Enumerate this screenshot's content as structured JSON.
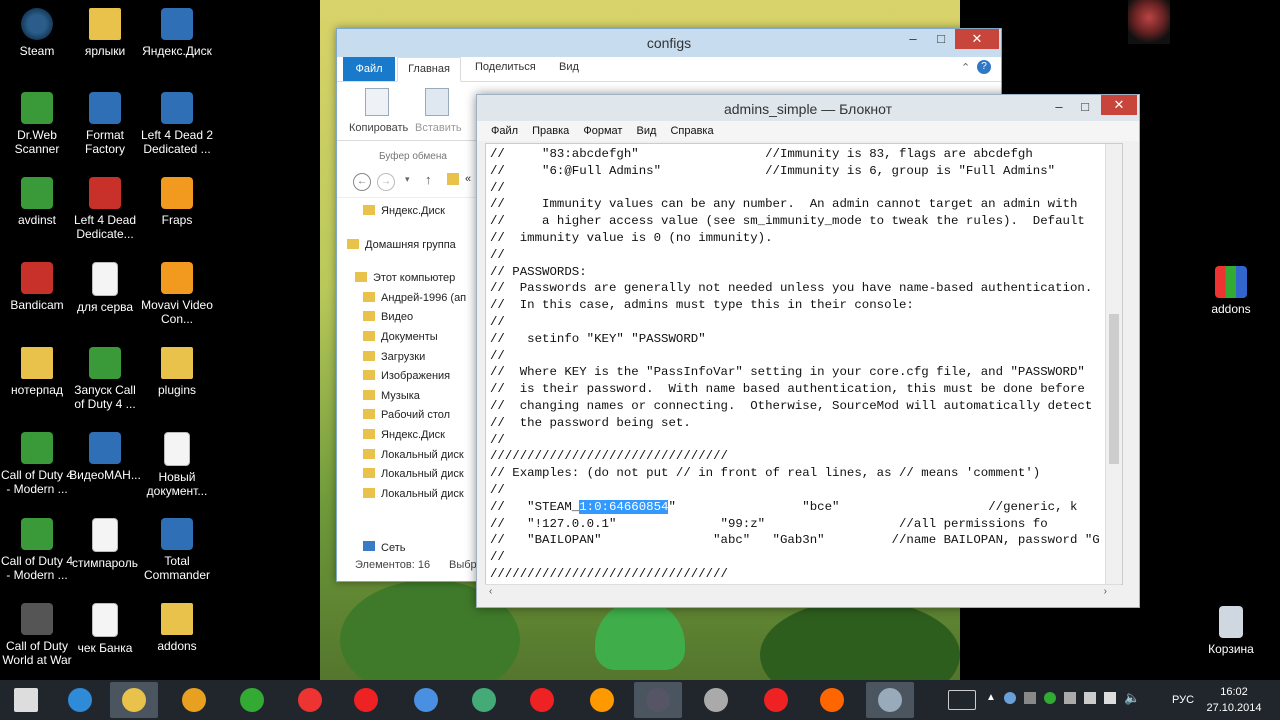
{
  "desktop": {
    "left_icons": [
      {
        "label": "Steam",
        "icon": "steam-icon"
      },
      {
        "label": "ярлыки",
        "icon": "folder-icon"
      },
      {
        "label": "Яндекс.Диск",
        "icon": "yandex-disk-icon"
      },
      {
        "label": "Dr.Web Scanner",
        "icon": "drweb-icon"
      },
      {
        "label": "Format Factory",
        "icon": "format-factory-icon"
      },
      {
        "label": "Left 4 Dead 2 Dedicated ...",
        "icon": "shortcut-icon"
      },
      {
        "label": "avdinst",
        "icon": "avdinst-icon"
      },
      {
        "label": "Left 4 Dead Dedicate...",
        "icon": "left4dead-icon"
      },
      {
        "label": "Fraps",
        "icon": "fraps-icon"
      },
      {
        "label": "Bandicam",
        "icon": "bandicam-icon"
      },
      {
        "label": "для серва",
        "icon": "document-icon"
      },
      {
        "label": "Movavi Video Con...",
        "icon": "movavi-icon"
      },
      {
        "label": "нотерпад",
        "icon": "folder-icon"
      },
      {
        "label": "Запуск Call of Duty 4 ...",
        "icon": "cod4-icon"
      },
      {
        "label": "plugins",
        "icon": "folder-icon"
      },
      {
        "label": "Call of Duty 4 - Modern ...",
        "icon": "cod4-icon"
      },
      {
        "label": "ВидеоМАН...",
        "icon": "video-icon"
      },
      {
        "label": "Новый документ...",
        "icon": "document-icon"
      },
      {
        "label": "Call of Duty 4 - Modern ...",
        "icon": "cod4-icon"
      },
      {
        "label": "стимпароль",
        "icon": "document-icon"
      },
      {
        "label": "Total Commander",
        "icon": "total-commander-icon"
      },
      {
        "label": "Call of Duty World at War",
        "icon": "codwaw-icon"
      },
      {
        "label": "чек Банка",
        "icon": "document-icon"
      },
      {
        "label": "addons",
        "icon": "folder-icon"
      }
    ],
    "right_icons": [
      {
        "label": "addons",
        "icon": "winrar-icon"
      },
      {
        "label": "Корзина",
        "icon": "recycle-bin-icon"
      }
    ]
  },
  "explorer": {
    "title": "configs",
    "tabs": {
      "file": "Файл",
      "home": "Главная",
      "share": "Поделиться",
      "view": "Вид"
    },
    "ribbon": {
      "copy": "Копировать",
      "paste": "Вставить",
      "clipboard": "Буфер обмена"
    },
    "nav": [
      "Яндекс.Диск",
      "Домашняя группа",
      "Этот компьютер",
      "Андрей-1996 (ап",
      "Видео",
      "Документы",
      "Загрузки",
      "Изображения",
      "Музыка",
      "Рабочий стол",
      "Яндекс.Диск",
      "Локальный диск",
      "Локальный диск",
      "Локальный диск"
    ],
    "network": "Сеть",
    "status": "Элементов: 16",
    "status_selected": "Выбр",
    "address": "«"
  },
  "notepad": {
    "title": "admins_simple — Блокнот",
    "menu": [
      "Файл",
      "Правка",
      "Формат",
      "Вид",
      "Справка"
    ],
    "lines_before": [
      "//     \"83:abcdefgh\"                 //Immunity is 83, flags are abcdefgh",
      "//     \"6:@Full Admins\"              //Immunity is 6, group is \"Full Admins\"",
      "//",
      "//     Immunity values can be any number.  An admin cannot target an admin with",
      "//     a higher access value (see sm_immunity_mode to tweak the rules).  Default",
      "//  immunity value is 0 (no immunity).",
      "//",
      "// PASSWORDS:",
      "//  Passwords are generally not needed unless you have name-based authentication.",
      "//  In this case, admins must type this in their console:",
      "//",
      "//   setinfo \"KEY\" \"PASSWORD\"",
      "//",
      "//  Where KEY is the \"PassInfoVar\" setting in your core.cfg file, and \"PASSWORD\"",
      "//  is their password.  With name based authentication, this must be done before",
      "//  changing names or connecting.  Otherwise, SourceMod will automatically detect",
      "//  the password being set.",
      "//",
      "////////////////////////////////",
      "// Examples: (do not put // in front of real lines, as // means 'comment')",
      "//"
    ],
    "steam_prefix": "//   \"STEAM_",
    "steam_selected": "1:0:64660854",
    "steam_suffix": "\"                 \"bce\"                    //generic, k",
    "lines_after": [
      "//   \"!127.0.0.1\"              \"99:z\"                  //all permissions fo",
      "//   \"BAILOPAN\"               \"abc\"   \"Gab3n\"         //name BAILOPAN, password \"G",
      "//",
      "////////////////////////////////"
    ]
  },
  "taskbar": {
    "language": "РУС",
    "time": "16:02",
    "date": "27.10.2014",
    "apps": [
      "start-icon",
      "ie-icon",
      "explorer-icon",
      "mail-icon",
      "utorrent-icon",
      "chrome-icon",
      "yandex-icon",
      "audio-icon",
      "network-pc-icon",
      "yandex-browser-icon",
      "mail-agent-icon",
      "steam-icon",
      "calendar-321-icon",
      "opera-icon",
      "firefox-icon",
      "notepad-icon"
    ]
  }
}
